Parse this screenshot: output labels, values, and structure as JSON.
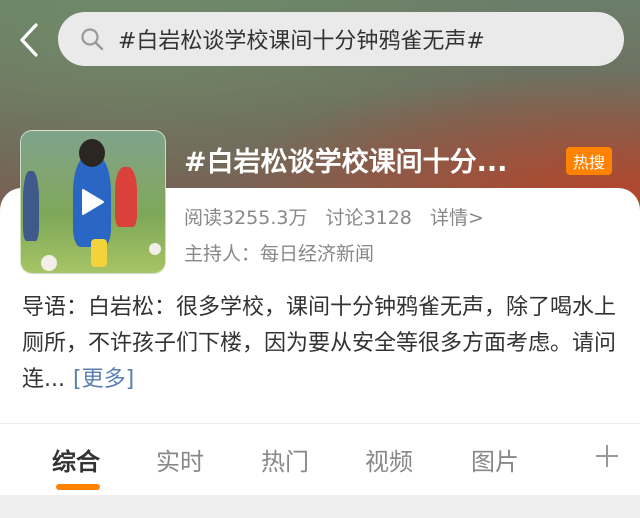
{
  "search": {
    "query": "#白岩松谈学校课间十分钟鸦雀无声#"
  },
  "topic": {
    "title": "#白岩松谈学校课间十分...",
    "badge": "热搜",
    "reads": "阅读3255.3万",
    "discussions": "讨论3128",
    "details": "详情>",
    "host": "主持人：每日经济新闻"
  },
  "intro": {
    "text": "导语：白岩松：很多学校，课间十分钟鸦雀无声，除了喝水上厕所，不许孩子们下楼，因为要从安全等很多方面考虑。请问连...",
    "more": "[更多]"
  },
  "tabs": [
    {
      "label": "综合",
      "active": true
    },
    {
      "label": "实时",
      "active": false
    },
    {
      "label": "热门",
      "active": false
    },
    {
      "label": "视频",
      "active": false
    },
    {
      "label": "图片",
      "active": false
    }
  ],
  "colors": {
    "accent": "#ff8200",
    "link": "#5b7fb4"
  },
  "icons": {
    "back": "chevron-left-icon",
    "search": "search-icon",
    "play": "play-icon",
    "add": "plus-icon"
  }
}
